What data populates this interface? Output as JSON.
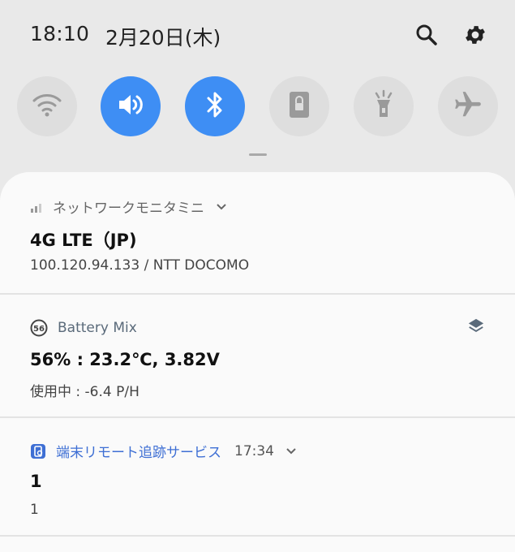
{
  "status": {
    "time": "18:10",
    "date": "2月20日(木)"
  },
  "toggles": [
    {
      "name": "wifi",
      "on": false
    },
    {
      "name": "sound",
      "on": true
    },
    {
      "name": "bluetooth",
      "on": true
    },
    {
      "name": "lock",
      "on": false
    },
    {
      "name": "flashlight",
      "on": false
    },
    {
      "name": "airplane",
      "on": false
    }
  ],
  "notifications": [
    {
      "app": "ネットワークモニタミニ",
      "title": "4G LTE（JP)",
      "body": "100.120.94.133 / NTT DOCOMO"
    },
    {
      "app": "Battery Mix",
      "badge": "56",
      "title": "56% : 23.2℃, 3.82V",
      "body": "使用中 : -6.4 P/H"
    },
    {
      "app": "端末リモート追跡サービス",
      "time": "17:34",
      "title": "1",
      "body": "1"
    }
  ],
  "colors": {
    "accent": "#3e8ef4",
    "off_toggle": "#dedede"
  }
}
